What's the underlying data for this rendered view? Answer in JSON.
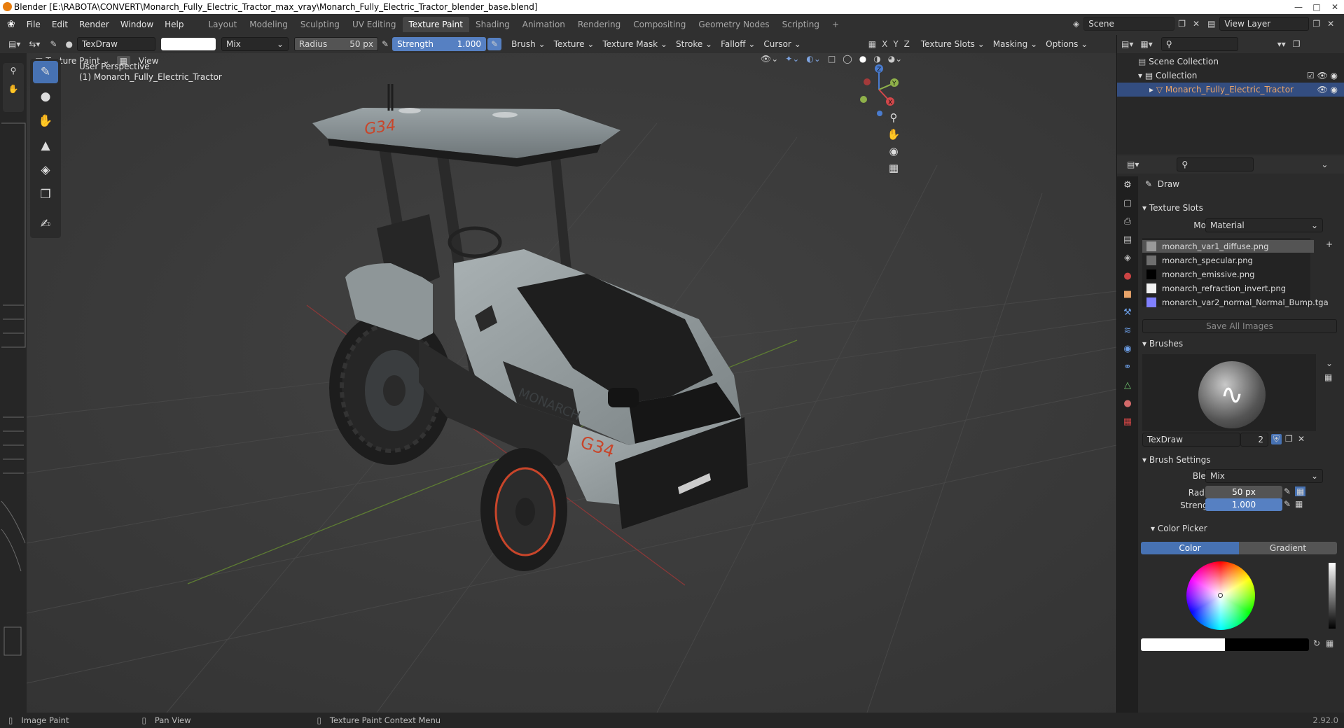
{
  "window": {
    "title": "Blender [E:\\RABOTA\\CONVERT\\Monarch_Fully_Electric_Tractor_max_vray\\Monarch_Fully_Electric_Tractor_blender_base.blend]"
  },
  "menu": [
    "File",
    "Edit",
    "Render",
    "Window",
    "Help"
  ],
  "workspaces": [
    "Layout",
    "Modeling",
    "Sculpting",
    "UV Editing",
    "Texture Paint",
    "Shading",
    "Animation",
    "Rendering",
    "Compositing",
    "Geometry Nodes",
    "Scripting"
  ],
  "active_workspace": "Texture Paint",
  "scene": {
    "name": "Scene",
    "view_layer": "View Layer"
  },
  "toolheader": {
    "brush_name": "TexDraw",
    "blend": "Mix",
    "radius_label": "Radius",
    "radius_value": "50 px",
    "strength_label": "Strength",
    "strength_value": "1.000",
    "menus": [
      "Brush",
      "Texture",
      "Texture Mask",
      "Stroke",
      "Falloff",
      "Cursor"
    ],
    "axes": [
      "X",
      "Y",
      "Z"
    ],
    "right_menus": [
      "Texture Slots",
      "Masking",
      "Options"
    ]
  },
  "viewport": {
    "mode": "Texture Paint",
    "view_menu": "View",
    "perspective": "User Perspective",
    "object_label": "(1) Monarch_Fully_Electric_Tractor",
    "gizmo": {
      "x": "X",
      "y": "Y",
      "z": "Z"
    },
    "decal_text": "G34",
    "hood_text": "MONARCH"
  },
  "outliner": {
    "scene_collection": "Scene Collection",
    "collection": "Collection",
    "object": "Monarch_Fully_Electric_Tractor"
  },
  "properties": {
    "tool_name": "Draw",
    "texture_slots": {
      "title": "Texture Slots",
      "mode_label": "Mode",
      "mode_value": "Material",
      "slots": [
        {
          "name": "monarch_var1_diffuse.png",
          "color": "#9a9a9a"
        },
        {
          "name": "monarch_specular.png",
          "color": "#6f6f6f"
        },
        {
          "name": "monarch_emissive.png",
          "color": "#000000"
        },
        {
          "name": "monarch_refraction_invert.png",
          "color": "#f2f2f2"
        },
        {
          "name": "monarch_var2_normal_Normal_Bump.tga",
          "color": "#8080ff"
        }
      ],
      "save_all": "Save All Images"
    },
    "brushes": {
      "title": "Brushes",
      "name": "TexDraw",
      "users": "2"
    },
    "brush_settings": {
      "title": "Brush Settings",
      "blend_label": "Blend",
      "blend_value": "Mix",
      "radius_label": "Radius",
      "radius_value": "50 px",
      "strength_label": "Strength",
      "strength_value": "1.000"
    },
    "color_picker": {
      "title": "Color Picker",
      "tab_color": "Color",
      "tab_gradient": "Gradient"
    }
  },
  "statusbar": {
    "left": "Image Paint",
    "middle": "Pan View",
    "right": "Texture Paint Context Menu",
    "version": "2.92.0"
  },
  "colors": {
    "accent": "#4772b3",
    "slider": "#5680c2",
    "selected_object": "#e8a46a",
    "header": "#303030",
    "viewport": "#393939"
  }
}
